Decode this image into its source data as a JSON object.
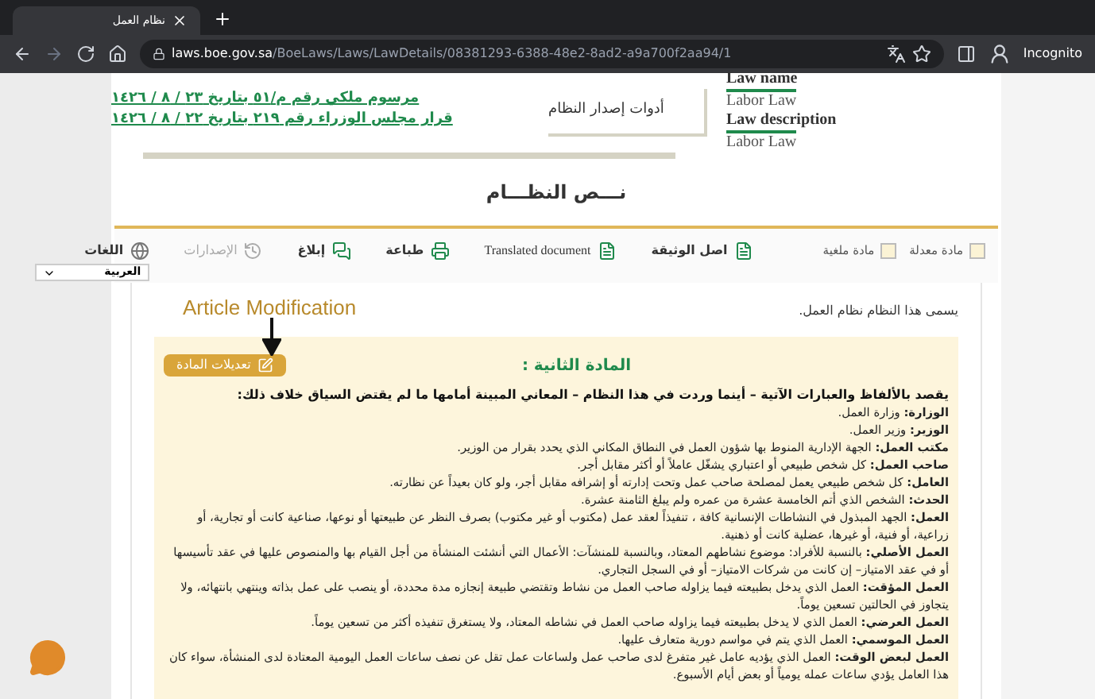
{
  "browser": {
    "tab_title": "نظام العمل",
    "url_host": "laws.boe.gov.sa",
    "url_path": "/BoeLaws/Laws/LawDetails/08381293-6388-48e2-8ad2-a9a700f2aa94/1",
    "mode": "Incognito"
  },
  "header": {
    "tools_label": "أدوات إصدار النظام",
    "instruments": [
      "مرسوم ملكي رقم م/٥١ بتاريخ ٢٣ / ٨ / ١٤٢٦",
      "قرار مجلس الوزراء رقم ٢١٩ بتاريخ ٢٢ / ٨ / ١٤٢٦"
    ],
    "law_name_label": "Law name",
    "law_name": "Labor Law",
    "law_description_label": "Law description",
    "law_description": "Labor Law"
  },
  "section_title": "نـــص النظـــام",
  "toolbar": {
    "legend": [
      {
        "label": "مادة معدلة",
        "checked": false
      },
      {
        "label": "مادة ملغية",
        "checked": false
      }
    ],
    "actions": [
      {
        "kind": "original",
        "label": "اصل الوثيقة",
        "disabled": false
      },
      {
        "kind": "translated",
        "label": "Translated document",
        "disabled": false
      },
      {
        "kind": "print",
        "label": "طباعة",
        "disabled": false
      },
      {
        "kind": "report",
        "label": "إبلاغ",
        "disabled": false
      },
      {
        "kind": "versions",
        "label": "الإصدارات",
        "disabled": true
      }
    ],
    "languages_label": "اللغات",
    "language": "العربية"
  },
  "intro": "يسمى هذا النظام نظام العمل.",
  "annotation": "Article Modification",
  "article": {
    "title": "المادة الثانية :",
    "modifications_button": "تعديلات المادة",
    "lead": "يقصد بالألفاظ والعبارات الآتية – أينما وردت في هذا النظام – المعاني المبينة أمامها ما لم يقتض السياق خلاف ذلك:",
    "definitions": [
      "**الوزارة:** وزارة العمل.",
      "**الوزير:** وزير العمل.",
      "**مكتب العمل:** الجهة الإدارية المنوط بها شؤون العمل في النطاق المكاني الذي يحدد بقرار من الوزير.",
      "**صاحب العمل:** كل شخص طبيعي أو اعتباري يشغّل عاملاً أو أكثر مقابل أجر.",
      "**العامل:** كل شخص طبيعي يعمل لمصلحة صاحب عمل وتحت إدارته أو إشرافه مقابل أجر، ولو كان بعيداً عن نظارته.",
      "**الحدث:** الشخص الذي أتم الخامسة عشرة من عمره ولم يبلغ الثامنة عشرة.",
      "**العمل:** الجهد المبذول في النشاطات الإنسانية كافة ، تنفيذاً لعقد عمل (مكتوب أو غير مكتوب) بصرف النظر عن طبيعتها أو نوعها، صناعية كانت أو تجارية، أو زراعية، أو فنية، أو غيرها، عضلية كانت أو ذهنية.",
      "**العمل الأصلي:** بالنسبة للأفراد: موضوع نشاطهم المعتاد، وبالنسبة للمنشآت: الأعمال التي أنشئت المنشأة من أجل القيام بها والمنصوص عليها في عقد تأسيسها أو في عقد الامتياز– إن كانت من شركات الامتياز– أو في السجل التجاري.",
      "**العمل المؤقت:** العمل الذي يدخل بطبيعته فيما يزاوله صاحب العمل من نشاط وتقتضي طبيعة إنجازه مدة محددة، أو ينصب على عمل بذاته وينتهي بانتهائه، ولا يتجاوز في الحالتين تسعين يوماً.",
      "**العمل العرضي:** العمل الذي لا يدخل بطبيعته فيما يزاوله صاحب العمل في نشاطه المعتاد، ولا يستغرق تنفيذه أكثر من تسعين يوماً.",
      "**العمل الموسمي:** العمل الذي يتم في مواسم دورية متعارف عليها.",
      "**العمل لبعض الوقت:** العمل الذي يؤديه عامل غير متفرغ لدى صاحب عمل ولساعات عمل تقل عن نصف ساعات العمل اليومية المعتادة لدى المنشأة، سواء كان هذا العامل يؤدي ساعات عمله يومياً أو بعض أيام الأسبوع."
    ]
  }
}
